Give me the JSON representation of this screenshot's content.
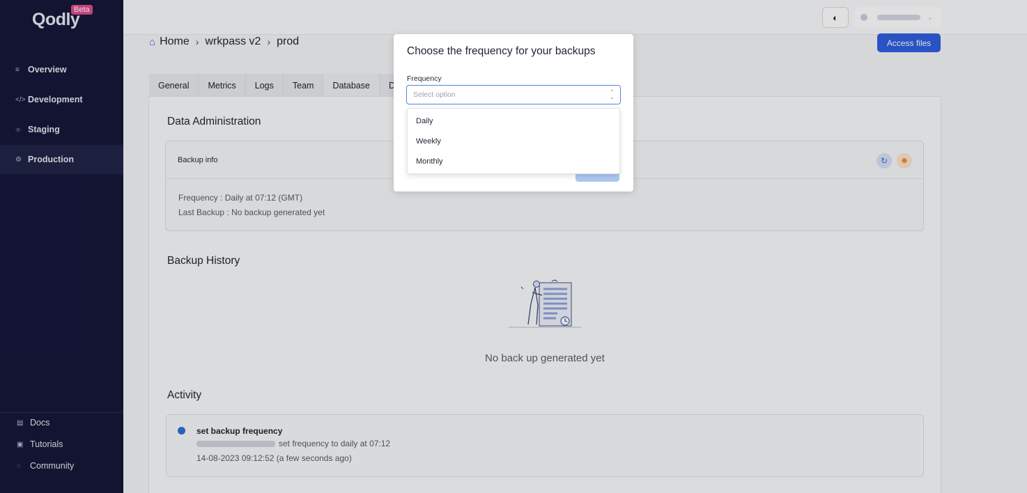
{
  "app": {
    "logo": "Qodly",
    "badge": "Beta"
  },
  "sidebar": {
    "items": [
      {
        "label": "Overview",
        "icon": "overview-icon"
      },
      {
        "label": "Development",
        "icon": "code-icon"
      },
      {
        "label": "Staging",
        "icon": "staging-icon"
      },
      {
        "label": "Production",
        "icon": "production-icon"
      }
    ],
    "footer": [
      {
        "label": "Docs",
        "icon": "docs-icon"
      },
      {
        "label": "Tutorials",
        "icon": "tutorials-icon"
      },
      {
        "label": "Community",
        "icon": "community-icon"
      }
    ]
  },
  "header": {
    "access_button": "Access files"
  },
  "breadcrumb": {
    "items": [
      "Home",
      "wrkpass v2",
      "prod"
    ]
  },
  "tabs": [
    "General",
    "Metrics",
    "Logs",
    "Team",
    "Database",
    "De"
  ],
  "data_admin": {
    "title": "Data Administration",
    "card_title": "Backup info",
    "frequency_label": "Frequency :",
    "frequency_value": "Daily at 07:12 (GMT)",
    "last_backup_label": "Last Backup :",
    "last_backup_value": "No backup generated yet"
  },
  "backup_history": {
    "title": "Backup History",
    "empty_text": "No back up generated yet"
  },
  "activity": {
    "title": "Activity",
    "items": [
      {
        "title": "set backup frequency",
        "text": "set frequency to daily at 07:12",
        "time": "14-08-2023 09:12:52 (a few seconds ago)"
      }
    ]
  },
  "modal": {
    "title": "Choose the frequency for your backups",
    "field_label": "Frequency",
    "placeholder": "Select option",
    "options": [
      "Daily",
      "Weekly",
      "Monthly"
    ]
  },
  "colors": {
    "sidebar_bg": "#16173a",
    "accent": "#2f5fe0",
    "refresh_icon": "#3a6fd8",
    "settings_icon": "#f08a24"
  }
}
